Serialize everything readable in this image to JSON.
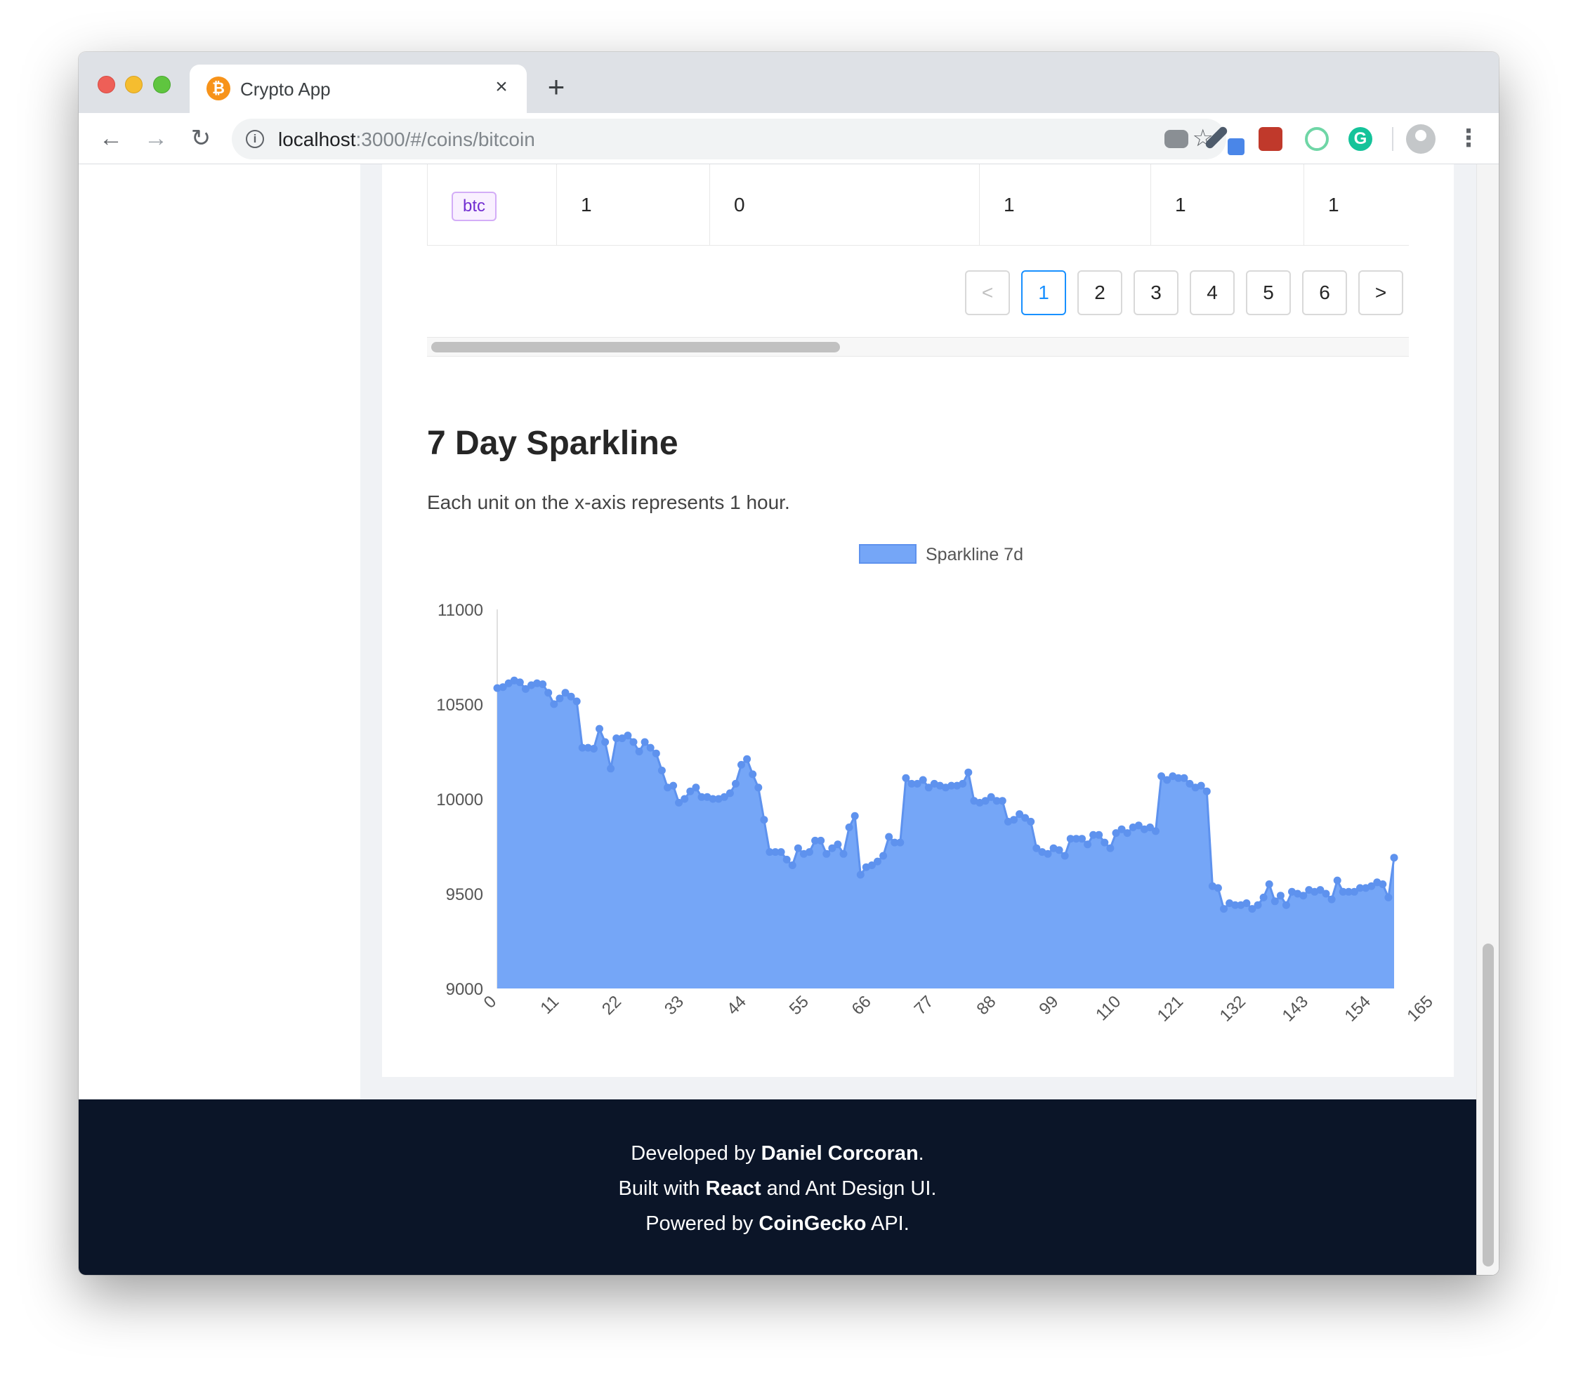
{
  "browser": {
    "tab_title": "Crypto App",
    "url_host": "localhost",
    "url_rest": ":3000/#/coins/bitcoin"
  },
  "table": {
    "row": [
      "btc",
      "1",
      "0",
      "1",
      "1",
      "1"
    ]
  },
  "pagination": {
    "prev": "<",
    "pages": [
      "1",
      "2",
      "3",
      "4",
      "5",
      "6"
    ],
    "active": "1",
    "next": ">"
  },
  "section": {
    "title": "7 Day Sparkline",
    "description": "Each unit on the x-axis represents 1 hour."
  },
  "chart_data": {
    "type": "area",
    "title": "",
    "xlabel": "",
    "ylabel": "",
    "legend_position": "top-center",
    "grid": false,
    "ylim": [
      9000,
      11000
    ],
    "yticks": [
      9000,
      9500,
      10000,
      10500,
      11000
    ],
    "xticks": [
      0,
      11,
      22,
      33,
      44,
      55,
      66,
      77,
      88,
      99,
      110,
      121,
      132,
      143,
      154,
      165
    ],
    "color": "#75a6f7",
    "point_color": "#5e92ee",
    "series": [
      {
        "name": "Sparkline 7d",
        "x_start": 0,
        "values": [
          10585,
          10590,
          10610,
          10625,
          10615,
          10580,
          10600,
          10610,
          10605,
          10560,
          10500,
          10530,
          10560,
          10540,
          10515,
          10270,
          10270,
          10265,
          10370,
          10300,
          10160,
          10320,
          10320,
          10335,
          10300,
          10250,
          10300,
          10270,
          10240,
          10150,
          10060,
          10070,
          9980,
          10000,
          10040,
          10060,
          10010,
          10010,
          10000,
          10000,
          10010,
          10030,
          10080,
          10180,
          10210,
          10130,
          10060,
          9890,
          9720,
          9720,
          9720,
          9680,
          9650,
          9740,
          9710,
          9720,
          9780,
          9780,
          9710,
          9740,
          9760,
          9710,
          9850,
          9910,
          9600,
          9640,
          9650,
          9670,
          9700,
          9800,
          9770,
          9770,
          10110,
          10080,
          10080,
          10100,
          10060,
          10080,
          10070,
          10060,
          10070,
          10070,
          10080,
          10140,
          9990,
          9980,
          9990,
          10010,
          9990,
          9990,
          9880,
          9890,
          9920,
          9900,
          9880,
          9740,
          9720,
          9710,
          9740,
          9730,
          9700,
          9790,
          9790,
          9790,
          9760,
          9810,
          9810,
          9770,
          9740,
          9820,
          9840,
          9820,
          9850,
          9860,
          9840,
          9850,
          9830,
          10120,
          10100,
          10120,
          10110,
          10110,
          10080,
          10060,
          10070,
          10040,
          9540,
          9530,
          9420,
          9450,
          9440,
          9440,
          9450,
          9420,
          9440,
          9480,
          9550,
          9460,
          9490,
          9440,
          9510,
          9500,
          9490,
          9520,
          9510,
          9520,
          9500,
          9470,
          9570,
          9510,
          9510,
          9510,
          9530,
          9530,
          9540,
          9560,
          9550,
          9480,
          9690
        ]
      }
    ]
  },
  "footer": {
    "line1_pre": "Developed by ",
    "line1_bold": "Daniel Corcoran",
    "line1_post": ".",
    "line2_pre": "Built with ",
    "line2_bold": "React",
    "line2_post": " and Ant Design UI.",
    "line3_pre": "Powered by ",
    "line3_bold": "CoinGecko",
    "line3_post": " API."
  }
}
